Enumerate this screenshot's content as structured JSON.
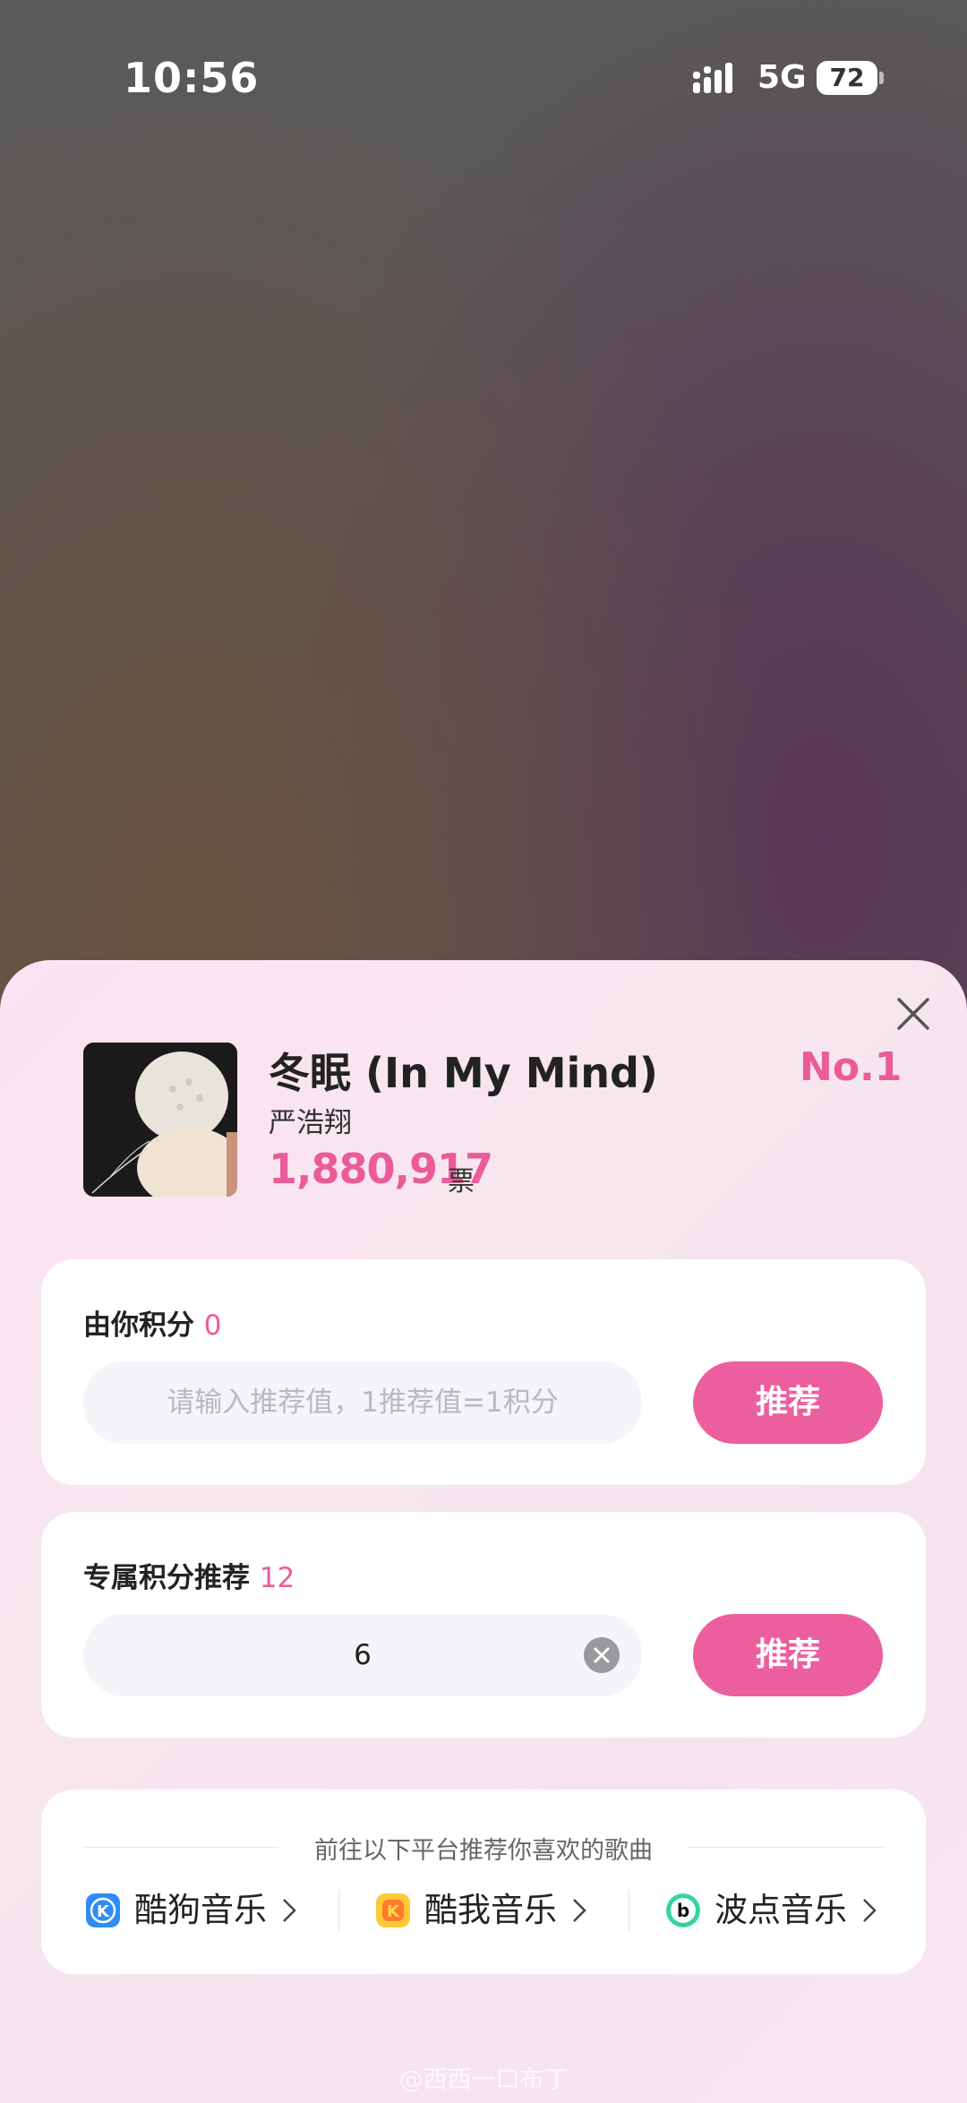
{
  "status_bar": {
    "time": "10:56",
    "network": "5G",
    "battery": "72"
  },
  "song": {
    "title": "冬眠 (In My Mind)",
    "artist": "严浩翔",
    "votes": "1,880,917",
    "votes_unit": "票",
    "rank": "No.1"
  },
  "card_points": {
    "label": "由你积分",
    "points": "0",
    "input_placeholder": "请输入推荐值，1推荐值=1积分",
    "button_label": "推荐"
  },
  "card_exclusive": {
    "label": "专属积分推荐",
    "points": "12",
    "input_value": "6",
    "button_label": "推荐"
  },
  "platforms": {
    "hint": "前往以下平台推荐你喜欢的歌曲",
    "items": [
      {
        "label": "酷狗音乐",
        "icon": "kugou-icon",
        "color": "#2f8cf6"
      },
      {
        "label": "酷我音乐",
        "icon": "kuwo-icon",
        "color": "#ffc93a"
      },
      {
        "label": "波点音乐",
        "icon": "bodian-icon",
        "color": "#32d3a3"
      }
    ]
  },
  "watermark": "@西西一口布丁",
  "colors": {
    "accent": "#eb5b9a",
    "button": "#ec5f9e"
  }
}
